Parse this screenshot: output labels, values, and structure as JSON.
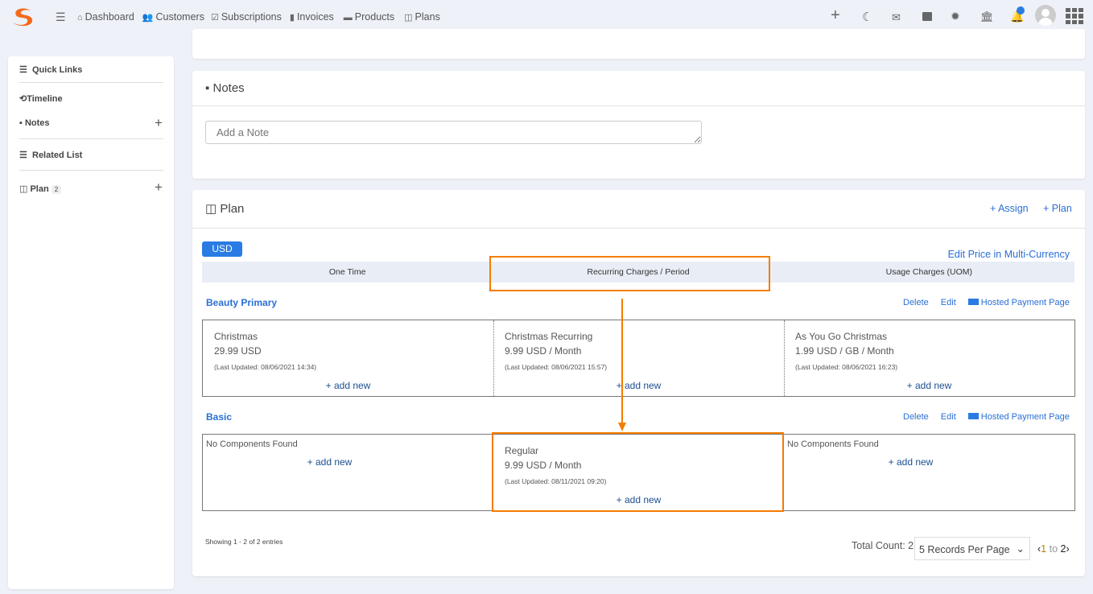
{
  "nav": {
    "items": [
      "Dashboard",
      "Customers",
      "Subscriptions",
      "Invoices",
      "Products",
      "Plans"
    ]
  },
  "topbar": {
    "icons": [
      "plus-icon",
      "moon-icon",
      "mail-icon",
      "calendar-icon",
      "gear-icon",
      "bank-icon",
      "bell-icon",
      "avatar",
      "apps-grid-icon"
    ],
    "notification_color": "#2a7be4"
  },
  "sidebar": {
    "quick_links": "Quick Links",
    "timeline": "Timeline",
    "notes": "Notes",
    "related_list": "Related List",
    "plan": "Plan",
    "plan_count": "2"
  },
  "notes": {
    "title": "Notes",
    "placeholder": "Add a Note"
  },
  "plan": {
    "title": "Plan",
    "assign": "+ Assign",
    "add_plan": "+ Plan",
    "currency": "USD",
    "edit_price": "Edit Price in Multi-Currency",
    "tabs": [
      "One Time",
      "Recurring Charges / Period",
      "Usage Charges (UOM)"
    ],
    "actions": {
      "delete": "Delete",
      "edit": "Edit",
      "hosted": "Hosted Payment Page"
    },
    "add_new": "+ add new",
    "groups": [
      {
        "name": "Beauty Primary",
        "cells": [
          {
            "name": "Christmas",
            "price": "29.99 USD",
            "updated": "(Last Updated: 08/06/2021 14:34)"
          },
          {
            "name": "Christmas Recurring",
            "price": "9.99 USD / Month",
            "updated": "(Last Updated: 08/06/2021 15:57)"
          },
          {
            "name": "As You Go Christmas",
            "price": "1.99 USD / GB / Month",
            "updated": "(Last Updated: 08/06/2021 16:23)"
          }
        ]
      },
      {
        "name": "Basic",
        "cells": [
          {
            "empty": "No Components Found"
          },
          {
            "name": "Regular",
            "price": "9.99 USD / Month",
            "updated": "(Last Updated: 08/11/2021 09:20)"
          },
          {
            "empty": "No Components Found"
          }
        ]
      }
    ],
    "showing": "Showing 1 - 2 of 2 entries",
    "total": "Total Count: 2",
    "per_page": "5 Records Per Page",
    "pager": {
      "from": "1",
      "to_label": "to",
      "to": "2"
    }
  },
  "highlight_color": "#f57c00"
}
